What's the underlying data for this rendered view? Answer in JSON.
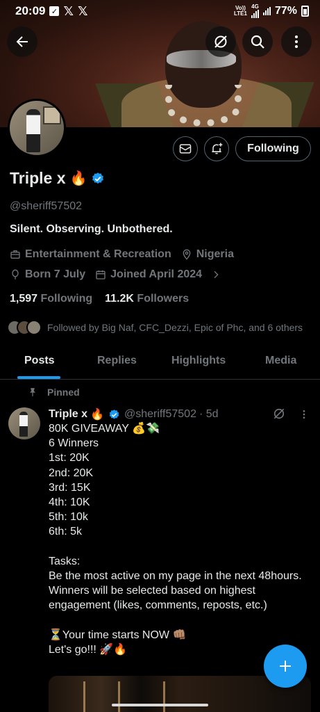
{
  "status_bar": {
    "time": "20:09",
    "net_label_top": "Vo))",
    "net_label_bottom": "LTE1",
    "net_type": "4G",
    "battery": "77%"
  },
  "profile": {
    "name": "Triple x",
    "name_emoji": "🔥",
    "handle": "@sheriff57502",
    "bio": "Silent. Observing. Unbothered.",
    "category": "Entertainment & Recreation",
    "location": "Nigeria",
    "born": "Born 7 July",
    "joined": "Joined April 2024",
    "following_count": "1,597",
    "following_label": "Following",
    "followers_count": "11.2K",
    "followers_label": "Followers",
    "followed_by": "Followed by Big Naf, CFC_Dezzi, Epic of Phc, and 6 others",
    "following_button": "Following"
  },
  "tabs": [
    {
      "label": "Posts"
    },
    {
      "label": "Replies"
    },
    {
      "label": "Highlights"
    },
    {
      "label": "Media"
    }
  ],
  "post": {
    "pinned_label": "Pinned",
    "author": "Triple x",
    "author_emoji": "🔥",
    "handle": "@sheriff57502",
    "time": "· 5d",
    "body": "80K GIVEAWAY 💰💸\n6 Winners\n1st: 20K\n2nd: 20K\n3rd: 15K\n4th: 10K\n5th: 10k\n6th: 5k\n\nTasks:\nBe the most active on my page in the next 48hours.\nWinners will be selected based on highest engagement (likes, comments, reposts, etc.)\n\n⏳Your time starts NOW 👊🏽\nLet's go!!! 🚀🔥"
  },
  "colors": {
    "accent": "#1d9bf0",
    "muted": "#71767b",
    "text": "#e7e9ea",
    "border": "#2f3336"
  },
  "icons": [
    "back-arrow-icon",
    "grok-icon",
    "search-icon",
    "more-vertical-icon",
    "mail-icon",
    "bell-plus-icon",
    "verified-badge-icon",
    "briefcase-icon",
    "location-pin-icon",
    "balloon-icon",
    "calendar-icon",
    "chevron-right-icon",
    "pin-icon",
    "plus-icon"
  ]
}
